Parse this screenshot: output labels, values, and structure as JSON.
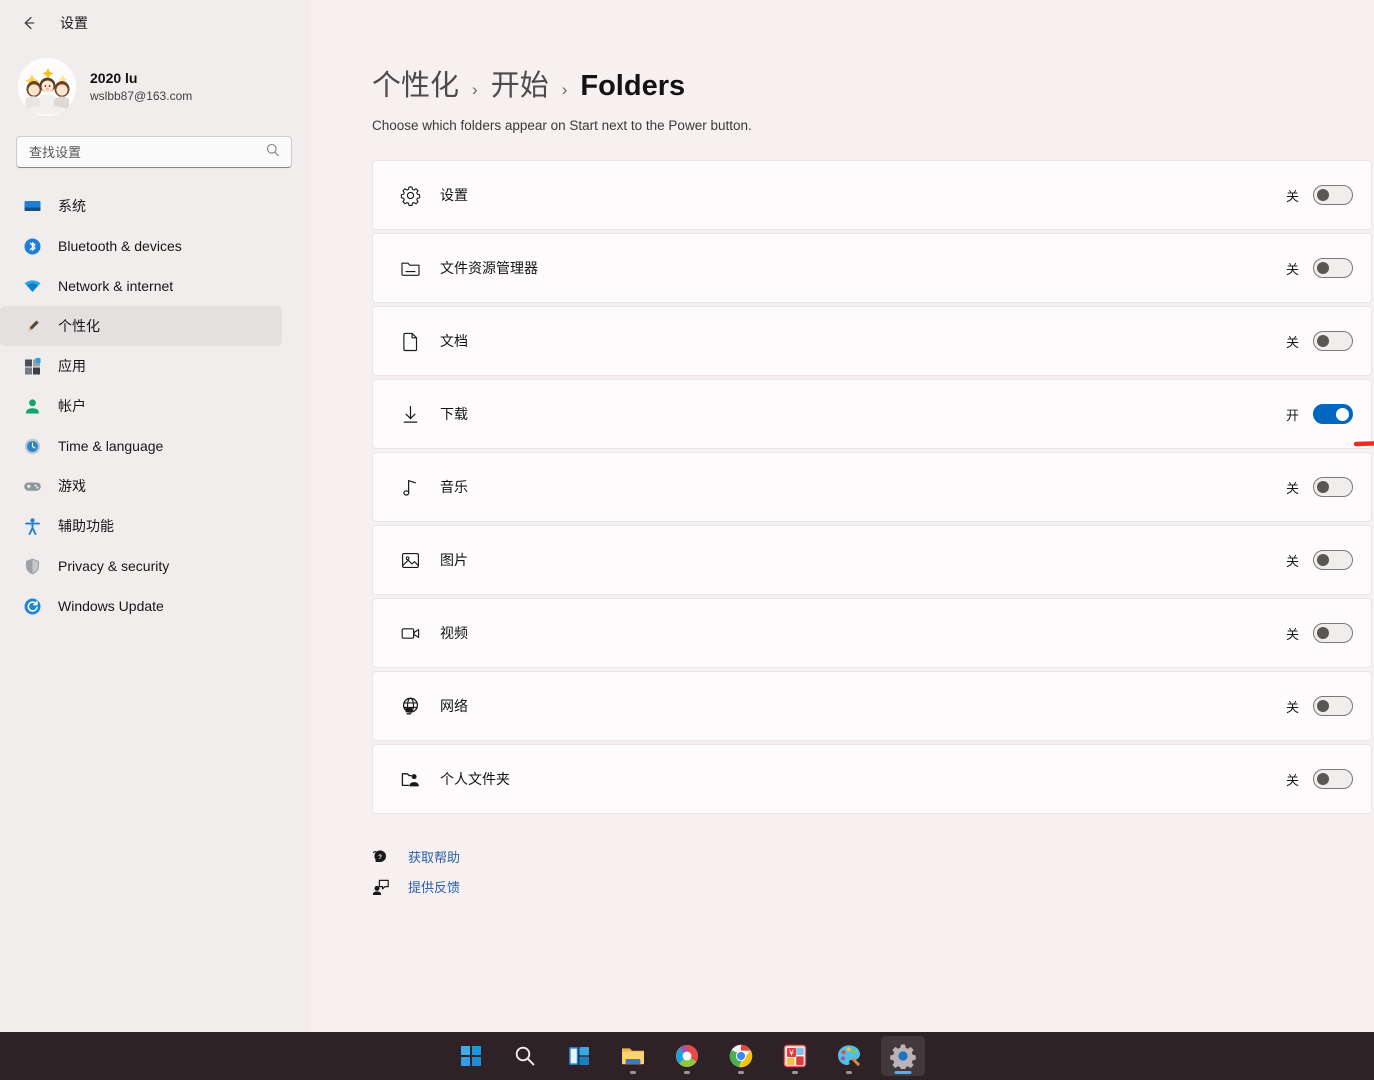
{
  "window": {
    "back_label": "back-arrow",
    "title": "设置"
  },
  "account": {
    "name": "2020 lu",
    "email": "wslbb87@163.com",
    "avatar_name": "user-avatar"
  },
  "search": {
    "placeholder": "查找设置",
    "value": "",
    "icon": "search-icon"
  },
  "sidebar": {
    "items": [
      {
        "label": "系统",
        "icon": "monitor-icon",
        "selected": false
      },
      {
        "label": "Bluetooth & devices",
        "icon": "bluetooth-icon",
        "selected": false
      },
      {
        "label": "Network & internet",
        "icon": "wifi-icon",
        "selected": false
      },
      {
        "label": "个性化",
        "icon": "paintbrush-icon",
        "selected": true
      },
      {
        "label": "应用",
        "icon": "apps-icon",
        "selected": false
      },
      {
        "label": "帐户",
        "icon": "person-icon",
        "selected": false
      },
      {
        "label": "Time & language",
        "icon": "clock-icon",
        "selected": false
      },
      {
        "label": "游戏",
        "icon": "gamepad-icon",
        "selected": false
      },
      {
        "label": "辅助功能",
        "icon": "accessibility-icon",
        "selected": false
      },
      {
        "label": "Privacy & security",
        "icon": "shield-icon",
        "selected": false
      },
      {
        "label": "Windows Update",
        "icon": "update-icon",
        "selected": false
      }
    ]
  },
  "main": {
    "breadcrumb": [
      {
        "label": "个性化",
        "current": false
      },
      {
        "label": "开始",
        "current": false
      },
      {
        "label": "Folders",
        "current": true
      }
    ],
    "separator": "›",
    "description": "Choose which folders appear on Start next to the Power button.",
    "folders": [
      {
        "label": "设置",
        "icon": "gear-icon",
        "state": "关",
        "on": false
      },
      {
        "label": "文件资源管理器",
        "icon": "folder-icon",
        "state": "关",
        "on": false
      },
      {
        "label": "文档",
        "icon": "document-icon",
        "state": "关",
        "on": false
      },
      {
        "label": "下载",
        "icon": "download-icon",
        "state": "开",
        "on": true
      },
      {
        "label": "音乐",
        "icon": "music-note-icon",
        "state": "关",
        "on": false
      },
      {
        "label": "图片",
        "icon": "picture-icon",
        "state": "关",
        "on": false
      },
      {
        "label": "视频",
        "icon": "video-camera-icon",
        "state": "关",
        "on": false
      },
      {
        "label": "网络",
        "icon": "network-globe-icon",
        "state": "关",
        "on": false
      },
      {
        "label": "个人文件夹",
        "icon": "personal-folder-icon",
        "state": "关",
        "on": false
      }
    ],
    "footer_links": [
      {
        "label": "获取帮助",
        "icon": "help-icon"
      },
      {
        "label": "提供反馈",
        "icon": "feedback-icon"
      }
    ]
  },
  "annotation": {
    "arrow_color": "#ef2a20",
    "points_to": "下载"
  },
  "taskbar": {
    "items": [
      {
        "name": "start-button",
        "active": false,
        "running": false
      },
      {
        "name": "search-button",
        "active": false,
        "running": false
      },
      {
        "name": "task-view-button",
        "active": false,
        "running": false
      },
      {
        "name": "file-explorer-button",
        "active": false,
        "running": true
      },
      {
        "name": "browser-button",
        "active": false,
        "running": true
      },
      {
        "name": "chrome-button",
        "active": false,
        "running": true
      },
      {
        "name": "finance-app-button",
        "active": false,
        "running": true
      },
      {
        "name": "paint-button",
        "active": false,
        "running": true
      },
      {
        "name": "settings-button",
        "active": true,
        "running": true
      }
    ]
  },
  "colors": {
    "accent": "#0067c0",
    "background": "#f6f0f0",
    "sidebar_bg": "#f2eded",
    "card_bg": "#fdfbfb",
    "taskbar_bg": "#2e2226",
    "link": "#2b5fa8",
    "annotation_red": "#ef2a20"
  }
}
